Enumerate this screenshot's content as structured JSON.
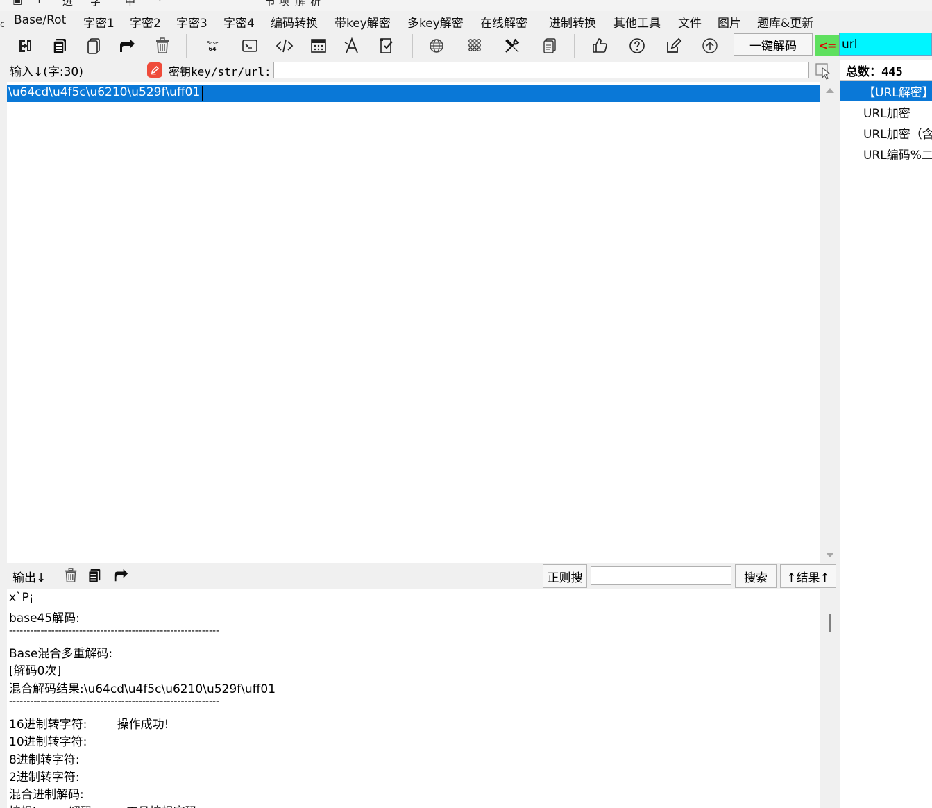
{
  "window": {
    "title_fragments": [
      "Ý",
      "⊡",
      "进",
      "字",
      "扬",
      "中",
      "·",
      "节",
      "坝",
      "解",
      "析"
    ]
  },
  "menu": {
    "items": [
      "Base/Rot",
      "字密1",
      "字密2",
      "字密3",
      "字密4",
      "编码转换",
      "带key解密",
      "多key解密",
      "在线解密",
      "进制转换",
      "其他工具",
      "文件",
      "图片",
      "题库&更新"
    ]
  },
  "toolbar": {
    "icons": [
      "import-icon",
      "copy-icon",
      "paste-icon",
      "share-icon",
      "delete-icon",
      "base64-icon",
      "terminal-icon",
      "code-icon",
      "calculator-icon",
      "font-icon",
      "checklist-icon",
      "globe-icon",
      "grid-icon",
      "tools-icon",
      "document-icon",
      "thumbs-up-icon",
      "help-icon",
      "edit-icon",
      "upload-icon"
    ],
    "base64_glyph": "Base\n64",
    "decode_button_label": "一键解码",
    "arrow_label": "<=",
    "filter_value": "url"
  },
  "input": {
    "label": "输入↓(字:30)",
    "key_label": "密钥key/str/url:",
    "key_value": "",
    "text": "\\u64cd\\u4f5c\\u6210\\u529f\\uff01"
  },
  "output": {
    "label": "输出↓",
    "regex_button": "正则搜",
    "search_value": "",
    "search_button": "搜索",
    "result_button": "↑结果↑",
    "lines": [
      "x`P¡",
      "base45解码:",
      "------------------------------------------------------------",
      "Base混合多重解码:",
      "[解码0次]",
      "混合解码结果:\\u64cd\\u4f5c\\u6210\\u529f\\uff01",
      "------------------------------------------------------------",
      "16进制转字符:        操作成功!",
      "10进制转字符:",
      "8进制转字符:",
      "2进制转字符:",
      "混合进制解码:",
      "培根bacon解码:        工具培根密码"
    ]
  },
  "sidebar": {
    "total_label": "总数：445",
    "items": [
      "【URL解密】",
      "URL加密",
      "URL加密（含",
      "URL编码%二"
    ]
  },
  "colors": {
    "selection": "#0a78d7",
    "filter_bg": "#00f5ff",
    "arrow_bg": "#5fe05f",
    "arrow_fg": "#e00000",
    "key_icon": "#ef4b3a"
  }
}
